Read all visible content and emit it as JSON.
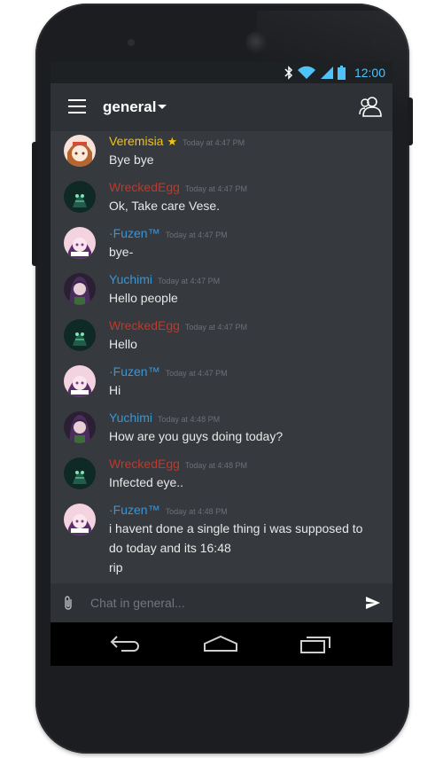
{
  "status": {
    "time": "12:00",
    "icons": [
      "bluetooth-icon",
      "wifi-icon",
      "signal-icon",
      "battery-icon"
    ]
  },
  "header": {
    "channel": "general",
    "menu_icon": "hamburger-menu-icon",
    "members_icon": "members-icon"
  },
  "messages": [
    {
      "author": "Veremisia",
      "author_color": "#f1c40f",
      "star": "★",
      "time": "Today at 4:47 PM",
      "lines": [
        "Bye bye"
      ],
      "avatar": "veremisia"
    },
    {
      "author": "WreckedEgg",
      "author_color": "#c0392b",
      "time": "Today at 4:47 PM",
      "lines": [
        "Ok, Take care Vese."
      ],
      "avatar": "wreckedegg"
    },
    {
      "author": "·Fuzen™",
      "author_color": "#3498db",
      "time": "Today at 4:47 PM",
      "lines": [
        "bye-"
      ],
      "avatar": "fuzen"
    },
    {
      "author": "Yuchimi",
      "author_color": "#3498db",
      "time": "Today at 4:47 PM",
      "lines": [
        "Hello people"
      ],
      "avatar": "yuchimi"
    },
    {
      "author": "WreckedEgg",
      "author_color": "#c0392b",
      "time": "Today at 4:47 PM",
      "lines": [
        "Hello"
      ],
      "avatar": "wreckedegg"
    },
    {
      "author": "·Fuzen™",
      "author_color": "#3498db",
      "time": "Today at 4:47 PM",
      "lines": [
        "Hi"
      ],
      "avatar": "fuzen"
    },
    {
      "author": "Yuchimi",
      "author_color": "#3498db",
      "time": "Today at 4:48 PM",
      "lines": [
        "How are you guys doing today?"
      ],
      "avatar": "yuchimi"
    },
    {
      "author": "WreckedEgg",
      "author_color": "#c0392b",
      "time": "Today at 4:48 PM",
      "lines": [
        "Infected eye.."
      ],
      "avatar": "wreckedegg"
    },
    {
      "author": "·Fuzen™",
      "author_color": "#3498db",
      "time": "Today at 4:48 PM",
      "lines": [
        "i havent done a single thing i was supposed to",
        "do today and its 16:48",
        "rip"
      ],
      "avatar": "fuzen"
    }
  ],
  "composer": {
    "placeholder": "Chat in general...",
    "attach_icon": "paperclip-icon",
    "send_icon": "send-icon"
  },
  "navbar": {
    "icons": [
      "back-icon",
      "home-icon",
      "recents-icon"
    ]
  },
  "colors": {
    "screen_bg": "#36393e",
    "bar_bg": "#2e3136",
    "status_bg": "#1e2124",
    "accent": "#4fc3f7"
  }
}
